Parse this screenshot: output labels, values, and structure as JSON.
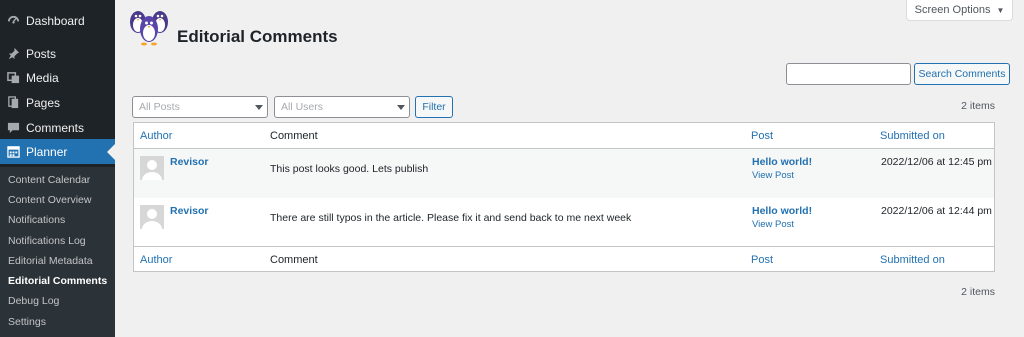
{
  "sidebar": {
    "items": [
      {
        "label": "Dashboard",
        "icon": "dashboard-icon"
      },
      {
        "label": "Posts",
        "icon": "pushpin-icon"
      },
      {
        "label": "Media",
        "icon": "media-icon"
      },
      {
        "label": "Pages",
        "icon": "pages-icon"
      },
      {
        "label": "Comments",
        "icon": "comments-icon"
      },
      {
        "label": "Planner",
        "icon": "calendar-icon"
      }
    ],
    "submenu": [
      "Content Calendar",
      "Content Overview",
      "Notifications",
      "Notifications Log",
      "Editorial Metadata",
      "Editorial Comments",
      "Debug Log",
      "Settings"
    ]
  },
  "header": {
    "screen_options": "Screen Options",
    "title": "Editorial Comments"
  },
  "search": {
    "value": "",
    "button": "Search Comments"
  },
  "filters": {
    "posts": "All Posts",
    "users": "All Users",
    "button": "Filter"
  },
  "items_count": "2 items",
  "table": {
    "columns": [
      "Author",
      "Comment",
      "Post",
      "Submitted on"
    ],
    "rows": [
      {
        "author": "Revisor",
        "comment": "This post looks good. Lets publish",
        "post": "Hello world!",
        "view_post": "View Post",
        "submitted": "2022/12/06 at 12:45 pm"
      },
      {
        "author": "Revisor",
        "comment": "There are still typos in the article. Please fix it and send back to me next week",
        "post": "Hello world!",
        "view_post": "View Post",
        "submitted": "2022/12/06 at 12:44 pm"
      }
    ]
  },
  "colors": {
    "accent": "#2271b1",
    "sidebar_bg": "#1d2327",
    "page_bg": "#f0f0f1"
  }
}
